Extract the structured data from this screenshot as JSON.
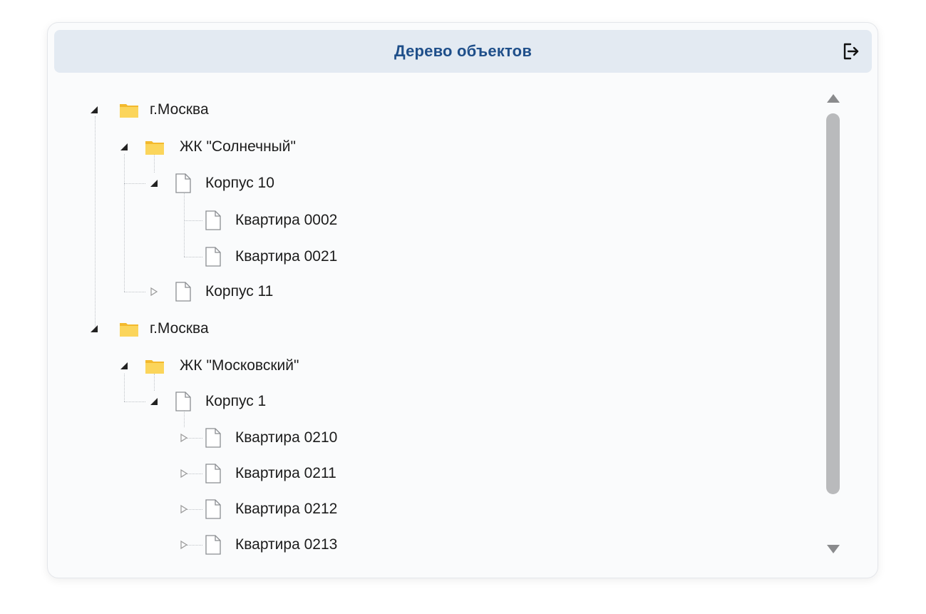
{
  "header": {
    "title": "Дерево объектов",
    "exit_icon": "logout-icon"
  },
  "tree": [
    {
      "label": "г.Москва",
      "type": "folder",
      "expanded": true
    },
    {
      "label": "ЖК \"Солнечный\"",
      "type": "folder",
      "expanded": true
    },
    {
      "label": "Корпус 10",
      "type": "file",
      "expanded": true
    },
    {
      "label": "Квартира 0002",
      "type": "file",
      "expanded": null
    },
    {
      "label": "Квартира 0021",
      "type": "file",
      "expanded": null
    },
    {
      "label": "Корпус 11",
      "type": "file",
      "expanded": false
    },
    {
      "label": "г.Москва",
      "type": "folder",
      "expanded": true
    },
    {
      "label": "ЖК \"Московский\"",
      "type": "folder",
      "expanded": true
    },
    {
      "label": "Корпус 1",
      "type": "file",
      "expanded": true
    },
    {
      "label": "Квартира 0210",
      "type": "file",
      "expanded": false
    },
    {
      "label": "Квартира 0211",
      "type": "file",
      "expanded": false
    },
    {
      "label": "Квартира 0212",
      "type": "file",
      "expanded": false
    },
    {
      "label": "Квартира 0213",
      "type": "file",
      "expanded": false
    }
  ],
  "colors": {
    "accent": "#1f4f8a",
    "header_bg": "#e3eaf2",
    "folder": "#f7c842"
  }
}
